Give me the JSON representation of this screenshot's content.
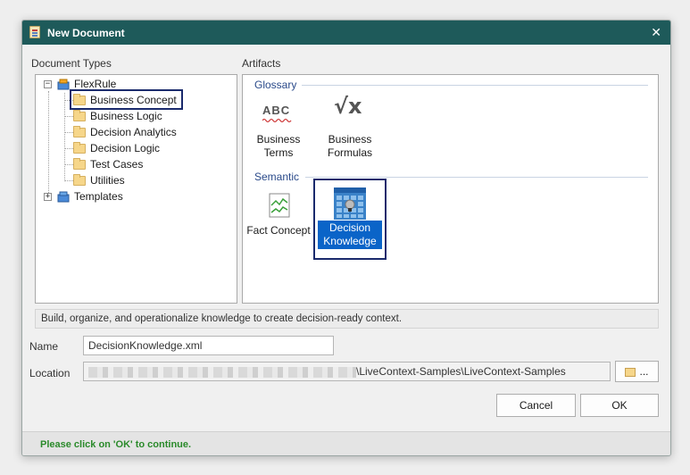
{
  "dialog": {
    "title": "New Document",
    "close_glyph": "✕"
  },
  "document_types": {
    "label": "Document Types",
    "tree": [
      {
        "label": "FlexRule",
        "icon": "database-icon",
        "expanded": true
      },
      {
        "label": "Business Concept",
        "icon": "folder-icon",
        "selected": true
      },
      {
        "label": "Business Logic",
        "icon": "folder-icon"
      },
      {
        "label": "Decision Analytics",
        "icon": "folder-icon"
      },
      {
        "label": "Decision Logic",
        "icon": "folder-icon"
      },
      {
        "label": "Test Cases",
        "icon": "folder-icon"
      },
      {
        "label": "Utilities",
        "icon": "folder-icon"
      },
      {
        "label": "Templates",
        "icon": "database-icon",
        "expanded": false
      }
    ],
    "expander_open": "−",
    "expander_closed": "+"
  },
  "artifacts": {
    "label": "Artifacts",
    "groups": [
      {
        "header": "Glossary",
        "items": [
          {
            "line1": "Business",
            "line2": "Terms",
            "icon": "abc-spell-icon"
          },
          {
            "line1": "Business",
            "line2": "Formulas",
            "icon": "square-root-x-icon"
          }
        ]
      },
      {
        "header": "Semantic",
        "items": [
          {
            "line1": "Fact Concept",
            "line2": "",
            "icon": "fact-chart-icon"
          },
          {
            "line1": "Decision",
            "line2": "Knowledge",
            "icon": "knowledge-grid-icon",
            "selected": true
          }
        ]
      }
    ],
    "abc_text": "ABC",
    "formula_text": "√x"
  },
  "description": "Build, organize, and operationalize knowledge to create decision-ready context.",
  "name": {
    "label": "Name",
    "value": "DecisionKnowledge.xml"
  },
  "location": {
    "label": "Location",
    "value_visible": "\\LiveContext-Samples\\LiveContext-Samples",
    "browse_label": "..."
  },
  "buttons": {
    "cancel": "Cancel",
    "ok": "OK"
  },
  "footer": {
    "message": "Please click on 'OK' to continue."
  },
  "colors": {
    "titlebar": "#1e5a5a",
    "selection": "#0a64c8",
    "highlight_border": "#1a2a6c",
    "footer_text": "#2a8a2a"
  }
}
